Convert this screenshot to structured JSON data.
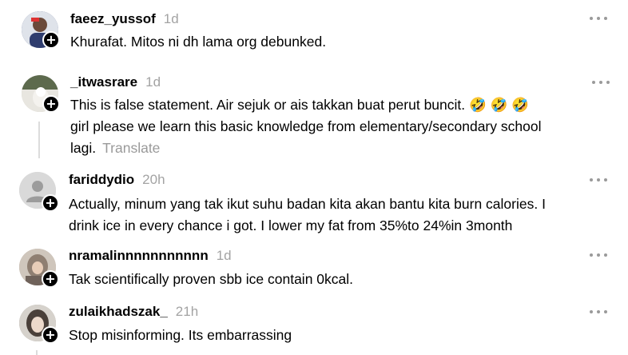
{
  "comments": [
    {
      "username": "faeez_yussof",
      "time": "1d",
      "text": "Khurafat. Mitos ni dh lama org debunked.",
      "avatar_icon": "profile-photo-man-red",
      "colors": {
        "avatar_bg": "#3b4a7a"
      }
    },
    {
      "username": "_itwasrare",
      "time": "1d",
      "text_line1": "This is false statement. Air sejuk or ais takkan buat perut buncit. 🤣 🤣 🤣",
      "text_line2": "girl please we learn this basic knowledge from elementary/secondary school",
      "text_line3": "lagi.",
      "translate": "Translate",
      "avatar_icon": "profile-photo-dog-outdoor",
      "colors": {
        "avatar_bg": "#c9c5bd"
      }
    },
    {
      "username": "fariddydio",
      "time": "20h",
      "text_line1": "Actually, minum yang tak ikut suhu badan kita akan bantu kita burn calories. I",
      "text_line2": "drink ice in every chance i got. I lower my fat from 35%to 24%in 3month",
      "avatar_icon": "default-person-icon",
      "colors": {
        "avatar_bg": "#d9d9d9"
      }
    },
    {
      "username": "nramalinnnnnnnnnnn",
      "time": "1d",
      "text": "Tak scientifically proven sbb ice contain 0kcal.",
      "avatar_icon": "profile-photo-hijab-woman",
      "colors": {
        "avatar_bg": "#b9a79a"
      }
    },
    {
      "username": "zulaikhadszak_",
      "time": "21h",
      "text": "Stop misinforming. Its embarrassing",
      "avatar_icon": "profile-photo-woman-light",
      "colors": {
        "avatar_bg": "#a8a39c"
      }
    }
  ]
}
